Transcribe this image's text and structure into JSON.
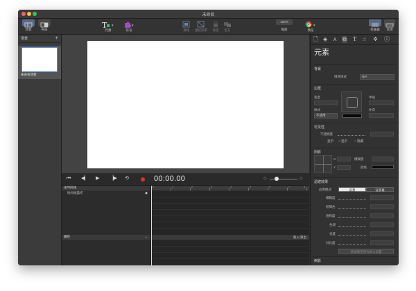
{
  "window": {
    "title": "未命名"
  },
  "toolbar": {
    "scenes_label": "场景",
    "layout_label": "布局",
    "elements_label": "元素",
    "symbols_label": "符号",
    "group_label": "群组",
    "group_mask_label": "围绕遮罩",
    "lock_label": "锁定",
    "align_label": "组方",
    "zoom_value": "100%",
    "zoom_label": "缩放",
    "preview_label": "预览",
    "inspector_label": "检查器",
    "resources_label": "资源"
  },
  "sidebar": {
    "title": "场景",
    "add_icon": "+",
    "scenes": [
      {
        "label": "未命名场景"
      }
    ]
  },
  "transport": {
    "timecode": "00:00.00",
    "icons": [
      "skip-start-icon",
      "step-back-icon",
      "play-icon",
      "step-forward-icon",
      "loop-icon",
      "record-icon"
    ]
  },
  "timeline": {
    "main_timeline_label": "主时间线",
    "actions_label": "时间线操作",
    "properties_label": "属性",
    "easing_label": "渐入/渐出",
    "ruler_marks": [
      "0",
      "1",
      "2",
      "3",
      "4",
      "5",
      "6",
      "7",
      "8"
    ]
  },
  "inspector": {
    "heading": "元素",
    "background": {
      "title": "背景",
      "fill_style_label": "填充样式",
      "fill_style_value": "N/A"
    },
    "border": {
      "title": "边框",
      "width_label": "宽度",
      "radius_label": "半径",
      "style_label": "样式",
      "style_value": "不适用",
      "padding_label": "补白"
    },
    "visibility": {
      "title": "可见性",
      "opacity_label": "不透明度",
      "display_label": "显示",
      "shown_label": "显示",
      "hidden_label": "隐藏"
    },
    "shadow": {
      "title": "阴影",
      "blur_label": "模糊度",
      "color_label": "颜色",
      "x_label": "X",
      "y_label": "Y"
    },
    "filters": {
      "title": "滤镜效果",
      "apply_mode_label": "应用模式",
      "mode_front": "前景",
      "mode_back": "背景幕",
      "blur": "模糊度",
      "grayscale": "棕褐色",
      "saturate": "饱和度",
      "hue": "色调",
      "brightness": "亮度",
      "contrast": "对比度",
      "reset_button": "将滤镜还原为默认设置"
    },
    "footer_section": "倒影"
  }
}
